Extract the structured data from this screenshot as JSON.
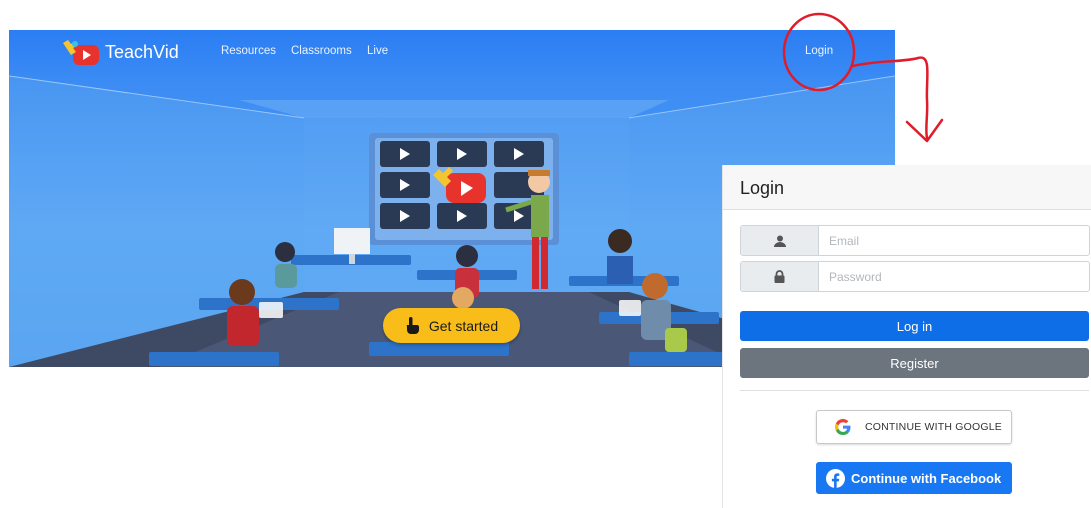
{
  "site": {
    "brand": "TeachVid",
    "nav": [
      "Resources",
      "Classrooms",
      "Live"
    ],
    "login_link": "Login",
    "cta": "Get started",
    "cta_icon": "pointing-hand-icon"
  },
  "login_panel": {
    "title": "Login",
    "email_placeholder": "Email",
    "email_icon": "user-icon",
    "password_placeholder": "Password",
    "password_icon": "lock-icon",
    "login_button": "Log in",
    "register_button": "Register",
    "google_button": "CONTINUE WITH GOOGLE",
    "facebook_button": "Continue with Facebook"
  },
  "colors": {
    "hero_blue": "#2b7ef3",
    "cta_yellow": "#f9bd1a",
    "primary": "#0d6ee8",
    "secondary": "#6c757d",
    "facebook": "#1877f2",
    "annotation_red": "#e01b2a"
  }
}
